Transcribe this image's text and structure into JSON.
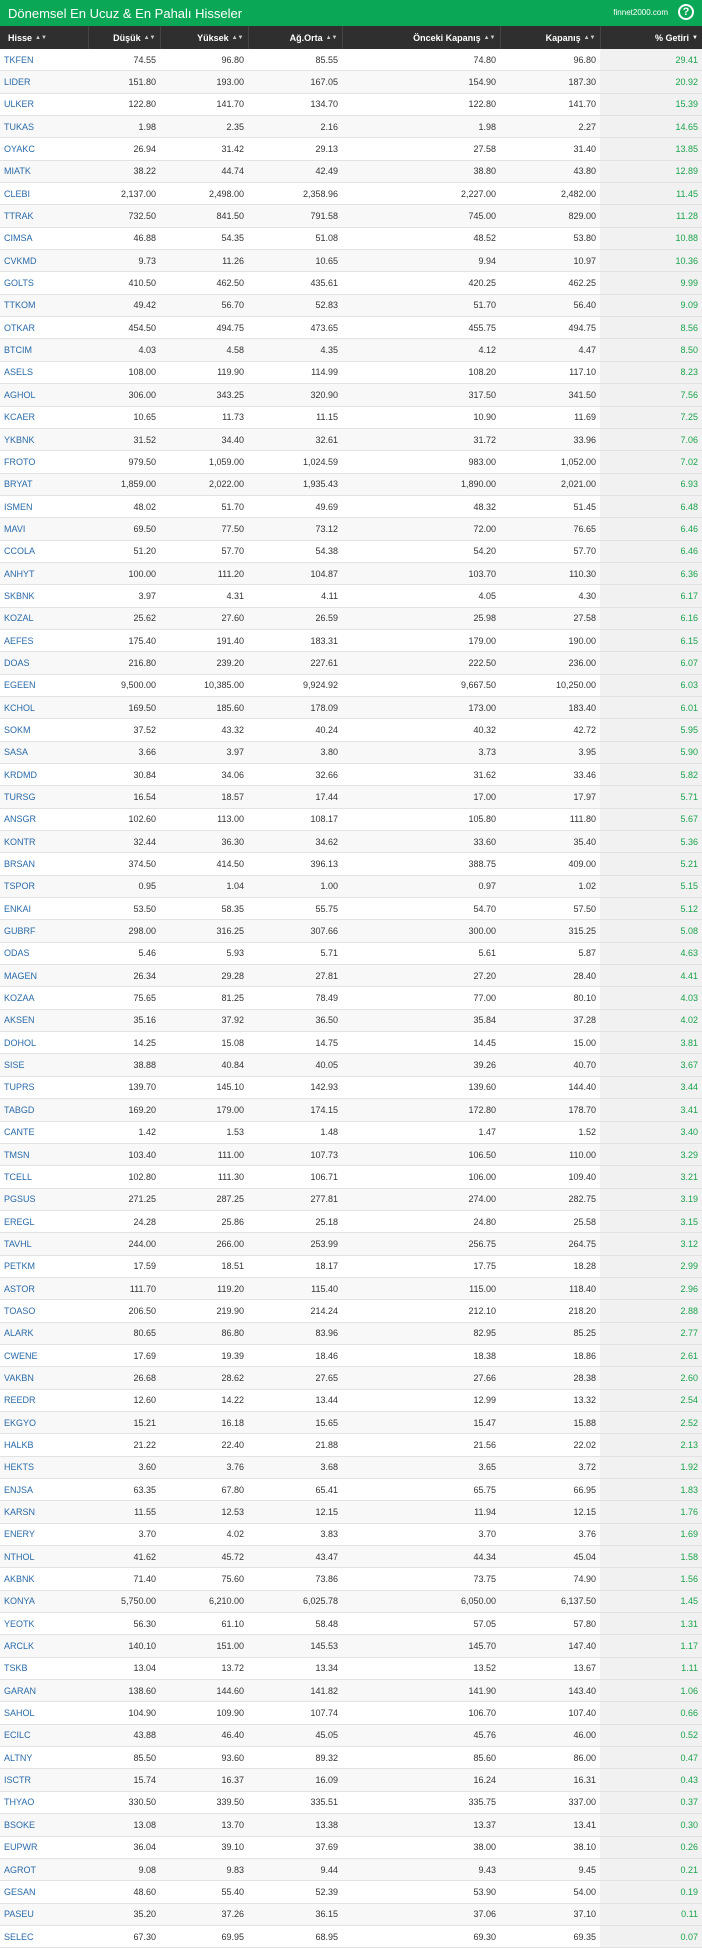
{
  "header": {
    "title": "Dönemsel En Ucuz & En Pahalı Hisseler",
    "brand": "finnet2000.com",
    "help": "?"
  },
  "columns": [
    "Hisse",
    "Düşük",
    "Yüksek",
    "Ağ.Orta",
    "Önceki Kapanış",
    "Kapanış",
    "% Getiri"
  ],
  "rows": [
    [
      "TKFEN",
      "74.55",
      "96.80",
      "85.55",
      "74.80",
      "96.80",
      "29.41"
    ],
    [
      "LIDER",
      "151.80",
      "193.00",
      "167.05",
      "154.90",
      "187.30",
      "20.92"
    ],
    [
      "ULKER",
      "122.80",
      "141.70",
      "134.70",
      "122.80",
      "141.70",
      "15.39"
    ],
    [
      "TUKAS",
      "1.98",
      "2.35",
      "2.16",
      "1.98",
      "2.27",
      "14.65"
    ],
    [
      "OYAKC",
      "26.94",
      "31.42",
      "29.13",
      "27.58",
      "31.40",
      "13.85"
    ],
    [
      "MIATK",
      "38.22",
      "44.74",
      "42.49",
      "38.80",
      "43.80",
      "12.89"
    ],
    [
      "CLEBI",
      "2,137.00",
      "2,498.00",
      "2,358.96",
      "2,227.00",
      "2,482.00",
      "11.45"
    ],
    [
      "TTRAK",
      "732.50",
      "841.50",
      "791.58",
      "745.00",
      "829.00",
      "11.28"
    ],
    [
      "CIMSA",
      "46.88",
      "54.35",
      "51.08",
      "48.52",
      "53.80",
      "10.88"
    ],
    [
      "CVKMD",
      "9.73",
      "11.26",
      "10.65",
      "9.94",
      "10.97",
      "10.36"
    ],
    [
      "GOLTS",
      "410.50",
      "462.50",
      "435.61",
      "420.25",
      "462.25",
      "9.99"
    ],
    [
      "TTKOM",
      "49.42",
      "56.70",
      "52.83",
      "51.70",
      "56.40",
      "9.09"
    ],
    [
      "OTKAR",
      "454.50",
      "494.75",
      "473.65",
      "455.75",
      "494.75",
      "8.56"
    ],
    [
      "BTCIM",
      "4.03",
      "4.58",
      "4.35",
      "4.12",
      "4.47",
      "8.50"
    ],
    [
      "ASELS",
      "108.00",
      "119.90",
      "114.99",
      "108.20",
      "117.10",
      "8.23"
    ],
    [
      "AGHOL",
      "306.00",
      "343.25",
      "320.90",
      "317.50",
      "341.50",
      "7.56"
    ],
    [
      "KCAER",
      "10.65",
      "11.73",
      "11.15",
      "10.90",
      "11.69",
      "7.25"
    ],
    [
      "YKBNK",
      "31.52",
      "34.40",
      "32.61",
      "31.72",
      "33.96",
      "7.06"
    ],
    [
      "FROTO",
      "979.50",
      "1,059.00",
      "1,024.59",
      "983.00",
      "1,052.00",
      "7.02"
    ],
    [
      "BRYAT",
      "1,859.00",
      "2,022.00",
      "1,935.43",
      "1,890.00",
      "2,021.00",
      "6.93"
    ],
    [
      "ISMEN",
      "48.02",
      "51.70",
      "49.69",
      "48.32",
      "51.45",
      "6.48"
    ],
    [
      "MAVI",
      "69.50",
      "77.50",
      "73.12",
      "72.00",
      "76.65",
      "6.46"
    ],
    [
      "CCOLA",
      "51.20",
      "57.70",
      "54.38",
      "54.20",
      "57.70",
      "6.46"
    ],
    [
      "ANHYT",
      "100.00",
      "111.20",
      "104.87",
      "103.70",
      "110.30",
      "6.36"
    ],
    [
      "SKBNK",
      "3.97",
      "4.31",
      "4.11",
      "4.05",
      "4.30",
      "6.17"
    ],
    [
      "KOZAL",
      "25.62",
      "27.60",
      "26.59",
      "25.98",
      "27.58",
      "6.16"
    ],
    [
      "AEFES",
      "175.40",
      "191.40",
      "183.31",
      "179.00",
      "190.00",
      "6.15"
    ],
    [
      "DOAS",
      "216.80",
      "239.20",
      "227.61",
      "222.50",
      "236.00",
      "6.07"
    ],
    [
      "EGEEN",
      "9,500.00",
      "10,385.00",
      "9,924.92",
      "9,667.50",
      "10,250.00",
      "6.03"
    ],
    [
      "KCHOL",
      "169.50",
      "185.60",
      "178.09",
      "173.00",
      "183.40",
      "6.01"
    ],
    [
      "SOKM",
      "37.52",
      "43.32",
      "40.24",
      "40.32",
      "42.72",
      "5.95"
    ],
    [
      "SASA",
      "3.66",
      "3.97",
      "3.80",
      "3.73",
      "3.95",
      "5.90"
    ],
    [
      "KRDMD",
      "30.84",
      "34.06",
      "32.66",
      "31.62",
      "33.46",
      "5.82"
    ],
    [
      "TURSG",
      "16.54",
      "18.57",
      "17.44",
      "17.00",
      "17.97",
      "5.71"
    ],
    [
      "ANSGR",
      "102.60",
      "113.00",
      "108.17",
      "105.80",
      "111.80",
      "5.67"
    ],
    [
      "KONTR",
      "32.44",
      "36.30",
      "34.62",
      "33.60",
      "35.40",
      "5.36"
    ],
    [
      "BRSAN",
      "374.50",
      "414.50",
      "396.13",
      "388.75",
      "409.00",
      "5.21"
    ],
    [
      "TSPOR",
      "0.95",
      "1.04",
      "1.00",
      "0.97",
      "1.02",
      "5.15"
    ],
    [
      "ENKAI",
      "53.50",
      "58.35",
      "55.75",
      "54.70",
      "57.50",
      "5.12"
    ],
    [
      "GUBRF",
      "298.00",
      "316.25",
      "307.66",
      "300.00",
      "315.25",
      "5.08"
    ],
    [
      "ODAS",
      "5.46",
      "5.93",
      "5.71",
      "5.61",
      "5.87",
      "4.63"
    ],
    [
      "MAGEN",
      "26.34",
      "29.28",
      "27.81",
      "27.20",
      "28.40",
      "4.41"
    ],
    [
      "KOZAA",
      "75.65",
      "81.25",
      "78.49",
      "77.00",
      "80.10",
      "4.03"
    ],
    [
      "AKSEN",
      "35.16",
      "37.92",
      "36.50",
      "35.84",
      "37.28",
      "4.02"
    ],
    [
      "DOHOL",
      "14.25",
      "15.08",
      "14.75",
      "14.45",
      "15.00",
      "3.81"
    ],
    [
      "SISE",
      "38.88",
      "40.84",
      "40.05",
      "39.26",
      "40.70",
      "3.67"
    ],
    [
      "TUPRS",
      "139.70",
      "145.10",
      "142.93",
      "139.60",
      "144.40",
      "3.44"
    ],
    [
      "TABGD",
      "169.20",
      "179.00",
      "174.15",
      "172.80",
      "178.70",
      "3.41"
    ],
    [
      "CANTE",
      "1.42",
      "1.53",
      "1.48",
      "1.47",
      "1.52",
      "3.40"
    ],
    [
      "TMSN",
      "103.40",
      "111.00",
      "107.73",
      "106.50",
      "110.00",
      "3.29"
    ],
    [
      "TCELL",
      "102.80",
      "111.30",
      "106.71",
      "106.00",
      "109.40",
      "3.21"
    ],
    [
      "PGSUS",
      "271.25",
      "287.25",
      "277.81",
      "274.00",
      "282.75",
      "3.19"
    ],
    [
      "EREGL",
      "24.28",
      "25.86",
      "25.18",
      "24.80",
      "25.58",
      "3.15"
    ],
    [
      "TAVHL",
      "244.00",
      "266.00",
      "253.99",
      "256.75",
      "264.75",
      "3.12"
    ],
    [
      "PETKM",
      "17.59",
      "18.51",
      "18.17",
      "17.75",
      "18.28",
      "2.99"
    ],
    [
      "ASTOR",
      "111.70",
      "119.20",
      "115.40",
      "115.00",
      "118.40",
      "2.96"
    ],
    [
      "TOASO",
      "206.50",
      "219.90",
      "214.24",
      "212.10",
      "218.20",
      "2.88"
    ],
    [
      "ALARK",
      "80.65",
      "86.80",
      "83.96",
      "82.95",
      "85.25",
      "2.77"
    ],
    [
      "CWENE",
      "17.69",
      "19.39",
      "18.46",
      "18.38",
      "18.86",
      "2.61"
    ],
    [
      "VAKBN",
      "26.68",
      "28.62",
      "27.65",
      "27.66",
      "28.38",
      "2.60"
    ],
    [
      "REEDR",
      "12.60",
      "14.22",
      "13.44",
      "12.99",
      "13.32",
      "2.54"
    ],
    [
      "EKGYO",
      "15.21",
      "16.18",
      "15.65",
      "15.47",
      "15.88",
      "2.52"
    ],
    [
      "HALKB",
      "21.22",
      "22.40",
      "21.88",
      "21.56",
      "22.02",
      "2.13"
    ],
    [
      "HEKTS",
      "3.60",
      "3.76",
      "3.68",
      "3.65",
      "3.72",
      "1.92"
    ],
    [
      "ENJSA",
      "63.35",
      "67.80",
      "65.41",
      "65.75",
      "66.95",
      "1.83"
    ],
    [
      "KARSN",
      "11.55",
      "12.53",
      "12.15",
      "11.94",
      "12.15",
      "1.76"
    ],
    [
      "ENERY",
      "3.70",
      "4.02",
      "3.83",
      "3.70",
      "3.76",
      "1.69"
    ],
    [
      "NTHOL",
      "41.62",
      "45.72",
      "43.47",
      "44.34",
      "45.04",
      "1.58"
    ],
    [
      "AKBNK",
      "71.40",
      "75.60",
      "73.86",
      "73.75",
      "74.90",
      "1.56"
    ],
    [
      "KONYA",
      "5,750.00",
      "6,210.00",
      "6,025.78",
      "6,050.00",
      "6,137.50",
      "1.45"
    ],
    [
      "YEOTK",
      "56.30",
      "61.10",
      "58.48",
      "57.05",
      "57.80",
      "1.31"
    ],
    [
      "ARCLK",
      "140.10",
      "151.00",
      "145.53",
      "145.70",
      "147.40",
      "1.17"
    ],
    [
      "TSKB",
      "13.04",
      "13.72",
      "13.34",
      "13.52",
      "13.67",
      "1.11"
    ],
    [
      "GARAN",
      "138.60",
      "144.60",
      "141.82",
      "141.90",
      "143.40",
      "1.06"
    ],
    [
      "SAHOL",
      "104.90",
      "109.90",
      "107.74",
      "106.70",
      "107.40",
      "0.66"
    ],
    [
      "ECILC",
      "43.88",
      "46.40",
      "45.05",
      "45.76",
      "46.00",
      "0.52"
    ],
    [
      "ALTNY",
      "85.50",
      "93.60",
      "89.32",
      "85.60",
      "86.00",
      "0.47"
    ],
    [
      "ISCTR",
      "15.74",
      "16.37",
      "16.09",
      "16.24",
      "16.31",
      "0.43"
    ],
    [
      "THYAO",
      "330.50",
      "339.50",
      "335.51",
      "335.75",
      "337.00",
      "0.37"
    ],
    [
      "BSOKE",
      "13.08",
      "13.70",
      "13.38",
      "13.37",
      "13.41",
      "0.30"
    ],
    [
      "EUPWR",
      "36.04",
      "39.10",
      "37.69",
      "38.00",
      "38.10",
      "0.26"
    ],
    [
      "AGROT",
      "9.08",
      "9.83",
      "9.44",
      "9.43",
      "9.45",
      "0.21"
    ],
    [
      "GESAN",
      "48.60",
      "55.40",
      "52.39",
      "53.90",
      "54.00",
      "0.19"
    ],
    [
      "PASEU",
      "35.20",
      "37.26",
      "36.15",
      "37.06",
      "37.10",
      "0.11"
    ],
    [
      "SELEC",
      "67.30",
      "69.95",
      "68.95",
      "69.30",
      "69.35",
      "0.07"
    ]
  ],
  "colors": {
    "header_bg": "#0aa856",
    "gain_text": "#1aa34a",
    "symbol_text": "#2a6aa8"
  }
}
